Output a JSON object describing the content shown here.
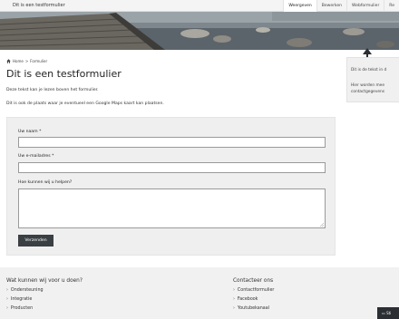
{
  "topbar": {
    "title": "Dit is een testformulier",
    "tabs": [
      {
        "label": "Weergeven",
        "active": true
      },
      {
        "label": "Bewerken",
        "active": false
      },
      {
        "label": "Webformulier",
        "active": false
      },
      {
        "label": "Re",
        "active": false
      }
    ]
  },
  "breadcrumb": {
    "home": "Home",
    "sep": ">",
    "current": "Formulier"
  },
  "page": {
    "title": "Dit is een testformulier",
    "intro1": "Deze tekst kan je lezen boven het formulier.",
    "intro2": "Dit is ook de plaats waar je eventueel een Google Maps kaart kan plaatsen."
  },
  "form": {
    "name_label": "Uw naam",
    "email_label": "Uw e-mailadres",
    "help_label": "Hoe kunnen wij u helpen?",
    "required_mark": "*",
    "submit_label": "Verzenden"
  },
  "sidebar": {
    "line1": "Dit is de tekst in d",
    "line2": "Hier worden mee",
    "line3": "contactgegevens"
  },
  "footer": {
    "col1": {
      "heading": "Wat kunnen wij voor u doen?",
      "items": [
        "Ondersteuning",
        "Integratie",
        "Producten"
      ]
    },
    "col2": {
      "heading": "Contacteer ons",
      "items": [
        "Contactformulier",
        "Facebook",
        "Youtubekanaal"
      ]
    },
    "chevron": "›",
    "chat_label": "Sti"
  },
  "colors": {
    "dark_button": "#3a3f44",
    "panel_bg": "#efefef",
    "footer_bg": "#f1f1f1"
  }
}
